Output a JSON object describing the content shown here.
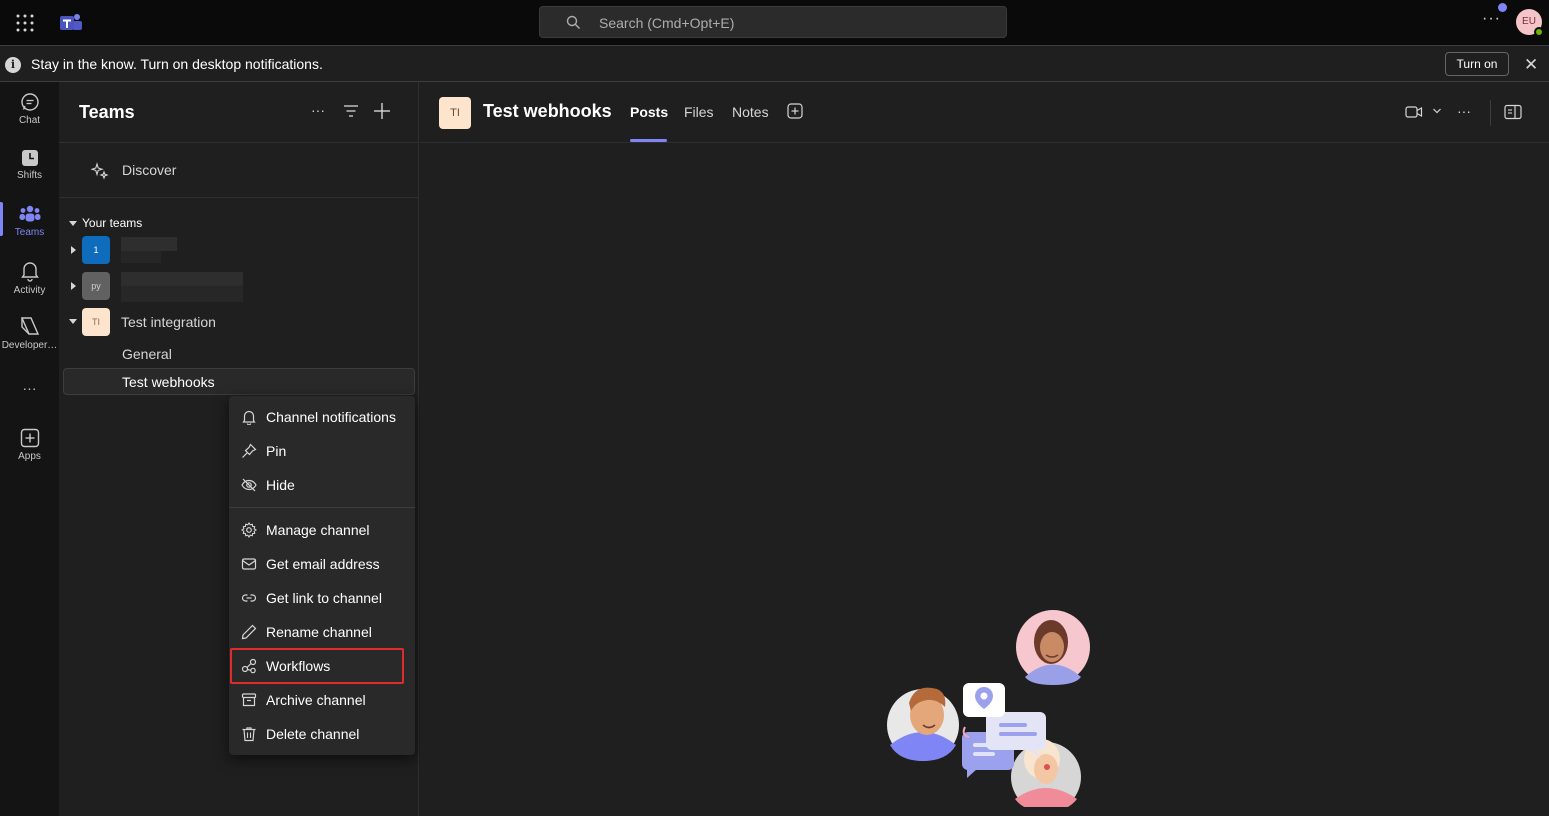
{
  "topbar": {
    "search_placeholder": "Search (Cmd+Opt+E)",
    "more": "···",
    "avatar_initials": "EU",
    "icons": [
      "waffle-icon",
      "teams-logo-icon",
      "search-icon"
    ]
  },
  "notification_bar": {
    "info": "i",
    "message": "Stay in the know. Turn on desktop notifications.",
    "turn_on_label": "Turn on",
    "close": "✕"
  },
  "rail": {
    "items": [
      {
        "label": "Chat",
        "icon": "chat-icon"
      },
      {
        "label": "Shifts",
        "icon": "clock-icon"
      },
      {
        "label": "Teams",
        "icon": "teams-icon",
        "active": true
      },
      {
        "label": "Activity",
        "icon": "bell-icon"
      },
      {
        "label": "Developer…",
        "icon": "developer-portal-icon"
      },
      {
        "label": "Apps",
        "icon": "apps-icon"
      }
    ],
    "more": "···",
    "accent_color": "#7f85f5"
  },
  "sidebar": {
    "title": "Teams",
    "more": "···",
    "discover_label": "Discover",
    "your_teams_label": "Your teams",
    "teams": [
      {
        "avatar": "1",
        "avatar_color": "#0f6cbd",
        "name": "",
        "expanded": false
      },
      {
        "avatar": "py",
        "avatar_color": "#616161",
        "name": "",
        "expanded": false
      },
      {
        "avatar": "TI",
        "avatar_color": "#fde5cd",
        "name": "Test integration",
        "expanded": true
      }
    ],
    "channels": [
      "General",
      "Test webhooks"
    ],
    "active_channel": "Test webhooks"
  },
  "context_menu": {
    "items": [
      {
        "label": "Channel notifications",
        "icon": "bell-icon"
      },
      {
        "label": "Pin",
        "icon": "pin-icon"
      },
      {
        "label": "Hide",
        "icon": "eye-off-icon"
      },
      {
        "label": "Manage channel",
        "icon": "gear-icon"
      },
      {
        "label": "Get email address",
        "icon": "mail-icon"
      },
      {
        "label": "Get link to channel",
        "icon": "link-icon"
      },
      {
        "label": "Rename channel",
        "icon": "pencil-icon"
      },
      {
        "label": "Workflows",
        "icon": "workflows-icon",
        "highlighted": true
      },
      {
        "label": "Archive channel",
        "icon": "archive-icon"
      },
      {
        "label": "Delete channel",
        "icon": "trash-icon"
      }
    ],
    "highlight_color": "#e02b2b"
  },
  "main": {
    "channel_avatar": "TI",
    "channel_title": "Test webhooks",
    "tabs": [
      {
        "label": "Posts",
        "active": true
      },
      {
        "label": "Files"
      },
      {
        "label": "Notes"
      }
    ],
    "more": "···"
  }
}
